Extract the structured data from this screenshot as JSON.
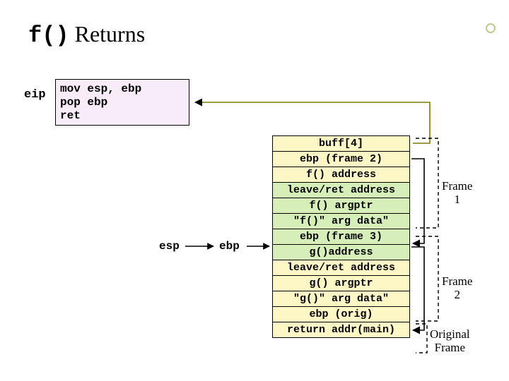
{
  "title": {
    "code": "f()",
    "rest": " Returns"
  },
  "eip_label": "eip",
  "asm": "mov esp, ebp\npop ebp\nret",
  "pointers": {
    "esp": "esp",
    "ebp": "ebp"
  },
  "stack": [
    {
      "text": "buff[4]",
      "color": "yellow"
    },
    {
      "text": "ebp (frame 2)",
      "color": "yellow"
    },
    {
      "text": "f() address",
      "color": "yellow"
    },
    {
      "text": "leave/ret address",
      "color": "green"
    },
    {
      "text": "f() argptr",
      "color": "green"
    },
    {
      "text": "\"f()\" arg data\"",
      "color": "green"
    },
    {
      "text": "ebp (frame 3)",
      "color": "green"
    },
    {
      "text": "g()address",
      "color": "green"
    },
    {
      "text": "leave/ret address",
      "color": "yellow"
    },
    {
      "text": "g() argptr",
      "color": "yellow"
    },
    {
      "text": "\"g()\" arg data\"",
      "color": "yellow"
    },
    {
      "text": "ebp (orig)",
      "color": "yellow"
    },
    {
      "text": "return addr(main)",
      "color": "yellow"
    }
  ],
  "frame_labels": {
    "f1": "Frame\n1",
    "f2": "Frame\n2",
    "orig": "Original\nFrame"
  }
}
